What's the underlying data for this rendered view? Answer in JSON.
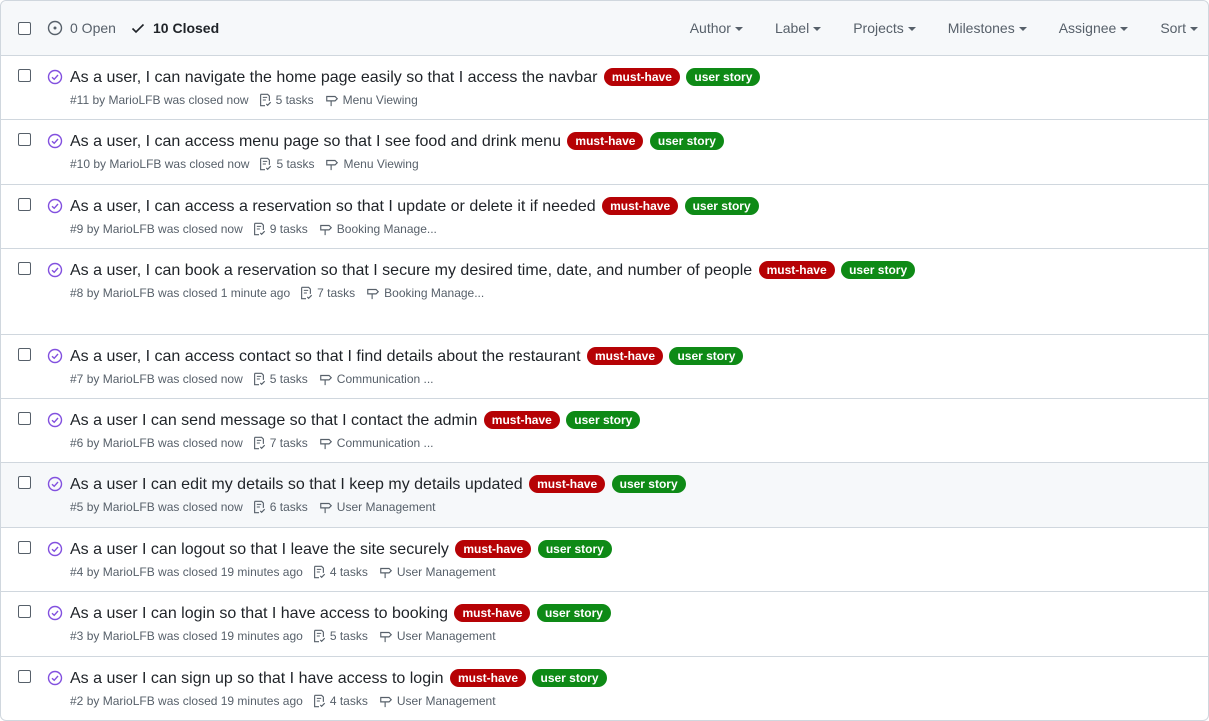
{
  "header": {
    "open_label": "0 Open",
    "closed_label": "10 Closed",
    "filters": [
      "Author",
      "Label",
      "Projects",
      "Milestones",
      "Assignee",
      "Sort"
    ]
  },
  "colors": {
    "must_have": "#b60205",
    "user_story": "#0e8a16",
    "closed_icon": "#8250df"
  },
  "issues": [
    {
      "title": "As a user, I can navigate the home page easily so that I access the navbar",
      "number": "#11",
      "meta": "by MarioLFB was closed now",
      "tasks": "5 tasks",
      "milestone": "Menu Viewing",
      "labels": [
        "must-have",
        "user story"
      ]
    },
    {
      "title": "As a user, I can access menu page so that I see food and drink menu",
      "number": "#10",
      "meta": "by MarioLFB was closed now",
      "tasks": "5 tasks",
      "milestone": "Menu Viewing",
      "labels": [
        "must-have",
        "user story"
      ]
    },
    {
      "title": "As a user, I can access a reservation so that I update or delete it if needed",
      "number": "#9",
      "meta": "by MarioLFB was closed now",
      "tasks": "9 tasks",
      "milestone": "Booking Manage...",
      "labels": [
        "must-have",
        "user story"
      ]
    },
    {
      "title": "As a user, I can book a reservation so that I secure my desired time, date, and number of people",
      "number": "#8",
      "meta": "by MarioLFB was closed 1 minute ago",
      "tasks": "7 tasks",
      "milestone": "Booking Manage...",
      "labels": [
        "must-have",
        "user story"
      ]
    },
    {
      "title": "As a user, I can access contact so that I find details about the restaurant",
      "number": "#7",
      "meta": "by MarioLFB was closed now",
      "tasks": "5 tasks",
      "milestone": "Communication ...",
      "labels": [
        "must-have",
        "user story"
      ]
    },
    {
      "title": "As a user I can send message so that I contact the admin",
      "number": "#6",
      "meta": "by MarioLFB was closed now",
      "tasks": "7 tasks",
      "milestone": "Communication ...",
      "labels": [
        "must-have",
        "user story"
      ]
    },
    {
      "title": "As a user I can edit my details so that I keep my details updated",
      "number": "#5",
      "meta": "by MarioLFB was closed now",
      "tasks": "6 tasks",
      "milestone": "User Management",
      "labels": [
        "must-have",
        "user story"
      ]
    },
    {
      "title": "As a user I can logout so that I leave the site securely",
      "number": "#4",
      "meta": "by MarioLFB was closed 19 minutes ago",
      "tasks": "4 tasks",
      "milestone": "User Management",
      "labels": [
        "must-have",
        "user story"
      ]
    },
    {
      "title": "As a user I can login so that I have access to booking",
      "number": "#3",
      "meta": "by MarioLFB was closed 19 minutes ago",
      "tasks": "5 tasks",
      "milestone": "User Management",
      "labels": [
        "must-have",
        "user story"
      ]
    },
    {
      "title": "As a user I can sign up so that I have access to login",
      "number": "#2",
      "meta": "by MarioLFB was closed 19 minutes ago",
      "tasks": "4 tasks",
      "milestone": "User Management",
      "labels": [
        "must-have",
        "user story"
      ]
    }
  ]
}
